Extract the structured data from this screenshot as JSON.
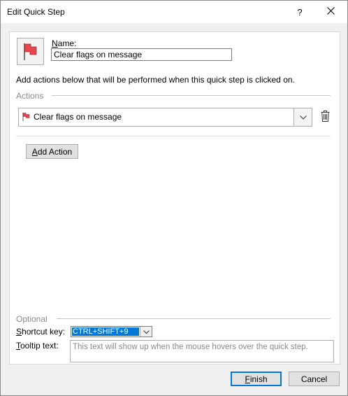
{
  "window": {
    "title": "Edit Quick Step",
    "help_glyph": "?",
    "close_glyph": "✕"
  },
  "quick_step": {
    "icon": "red-flag-icon",
    "name_label_underlined": "N",
    "name_label_rest": "ame:",
    "name_value": "Clear flags on message",
    "instructions": "Add actions below that will be performed when this quick step is clicked on."
  },
  "actions": {
    "group_label": "Actions",
    "items": [
      {
        "icon": "red-flag-icon",
        "label": "Clear flags on message"
      }
    ],
    "delete_icon": "trash-icon",
    "add_label_underlined": "A",
    "add_label_rest": "dd Action"
  },
  "optional": {
    "group_label": "Optional",
    "shortcut_label_underlined": "S",
    "shortcut_label_rest": "hortcut key:",
    "shortcut_value": "CTRL+SHIFT+9",
    "tooltip_label_underlined": "T",
    "tooltip_label_rest": "ooltip text:",
    "tooltip_placeholder": "This text will show up when the mouse hovers over the quick step."
  },
  "footer": {
    "finish_underlined": "F",
    "finish_rest": "inish",
    "cancel_label": "Cancel"
  },
  "colors": {
    "flag_red": "#e8464f",
    "accent": "#0078d7"
  }
}
